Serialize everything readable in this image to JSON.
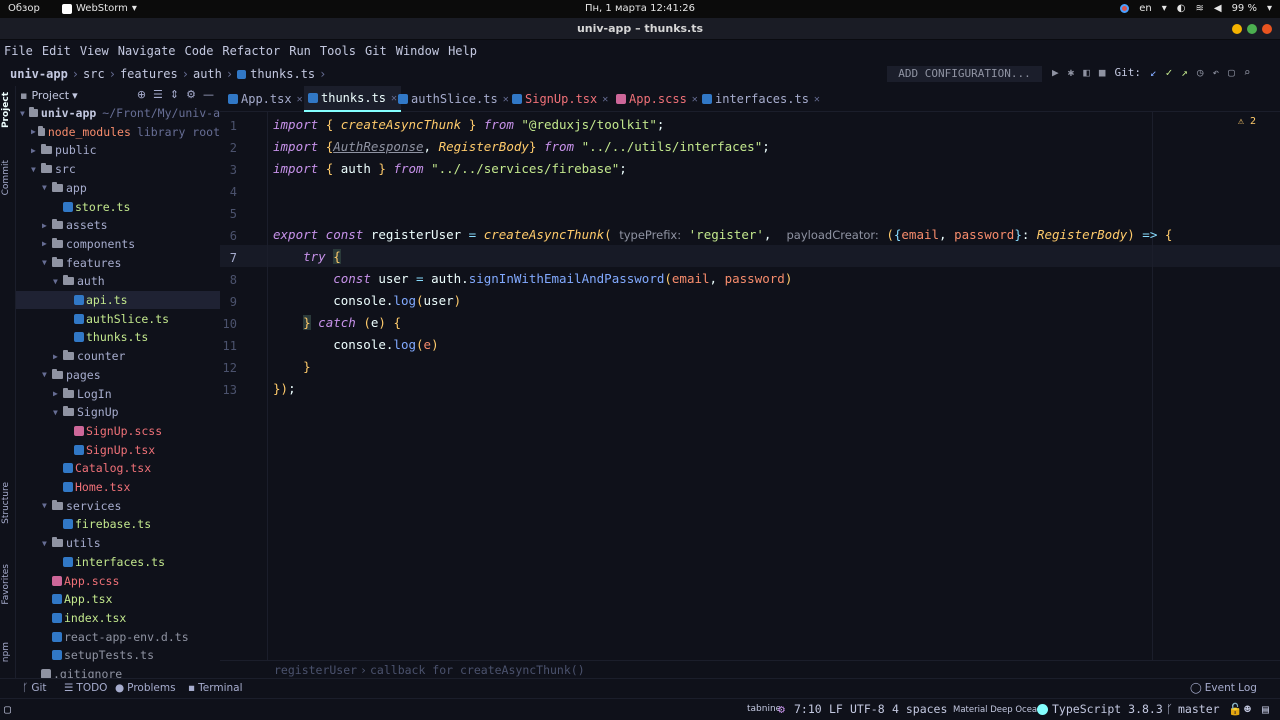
{
  "gnome": {
    "overview": "Обзор",
    "app": "WebStorm",
    "clock": "Пн, 1 марта  12:41:26",
    "lang": "en",
    "battery": "99 %"
  },
  "window": {
    "title": "univ-app – thunks.ts"
  },
  "menu": [
    "File",
    "Edit",
    "View",
    "Navigate",
    "Code",
    "Refactor",
    "Run",
    "Tools",
    "Git",
    "Window",
    "Help"
  ],
  "nav": {
    "crumbs": [
      "univ-app",
      "src",
      "features",
      "auth",
      "thunks.ts"
    ],
    "run_config": "ADD CONFIGURATION...",
    "git_label": "Git:"
  },
  "side_tabs": {
    "project": "Project",
    "commit": "Commit",
    "structure": "Structure",
    "favorites": "Favorites",
    "npm": "npm"
  },
  "project": {
    "header": "Project",
    "root": "univ-app",
    "root_path": "~/Front/My/univ-a",
    "node_modules": "node_modules",
    "library_root": "library root",
    "items": {
      "public": "public",
      "src": "src",
      "app": "app",
      "store": "store.ts",
      "assets": "assets",
      "components": "components",
      "features": "features",
      "auth": "auth",
      "api": "api.ts",
      "authSlice": "authSlice.ts",
      "thunks": "thunks.ts",
      "counter": "counter",
      "pages": "pages",
      "login": "LogIn",
      "signup": "SignUp",
      "signup_scss": "SignUp.scss",
      "signup_tsx": "SignUp.tsx",
      "catalog": "Catalog.tsx",
      "home": "Home.tsx",
      "services": "services",
      "firebase": "firebase.ts",
      "utils": "utils",
      "interfaces": "interfaces.ts",
      "app_scss": "App.scss",
      "app_tsx": "App.tsx",
      "index": "index.tsx",
      "react_env": "react-app-env.d.ts",
      "setup_tests": "setupTests.ts",
      "gitignore": ".gitignore"
    }
  },
  "tabs": [
    "App.tsx",
    "thunks.ts",
    "authSlice.ts",
    "SignUp.tsx",
    "App.scss",
    "interfaces.ts"
  ],
  "editor": {
    "line_numbers": [
      "1",
      "2",
      "3",
      "4",
      "5",
      "6",
      "7",
      "8",
      "9",
      "10",
      "11",
      "12",
      "13"
    ],
    "warnings": "2",
    "hint_type_prefix": "typePrefix:",
    "hint_payload_creator": "payloadCreator:",
    "crumb_func": "registerUser",
    "crumb_callback": "callback for createAsyncThunk()"
  },
  "tool_windows": [
    "Git",
    "TODO",
    "Problems",
    "Terminal",
    "Event Log"
  ],
  "status": {
    "tabnine": "tabnine",
    "position": "7:10",
    "line_sep": "LF",
    "encoding": "UTF-8",
    "indent": "4 spaces",
    "theme": "Material Deep Ocean",
    "lang": "TypeScript 3.8.3",
    "branch": "master"
  },
  "colors": {
    "accent": "#84ffff",
    "bg": "#0f111a",
    "keyword": "#c792ea",
    "string": "#c3e88d",
    "function": "#82aaff",
    "type": "#ffcb6b"
  }
}
